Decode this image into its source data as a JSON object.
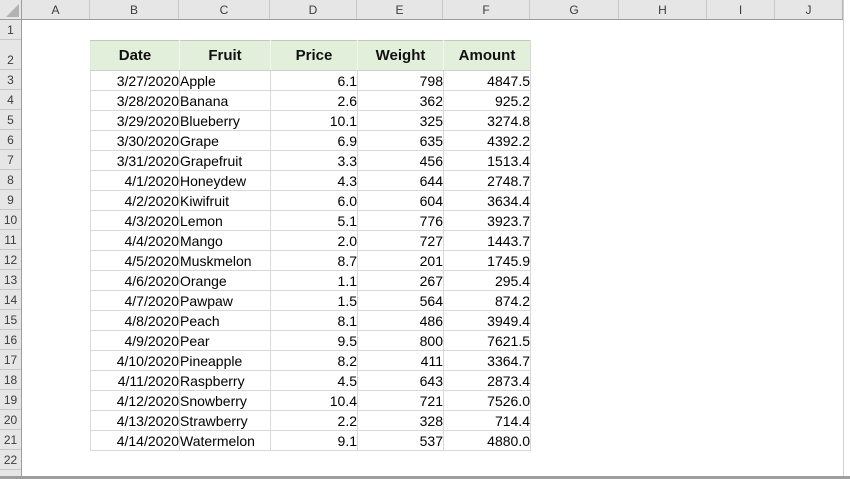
{
  "spreadsheet": {
    "column_letters": [
      "A",
      "B",
      "C",
      "D",
      "E",
      "F",
      "G",
      "H",
      "I",
      "J"
    ],
    "row_numbers": [
      "1",
      "2",
      "3",
      "4",
      "5",
      "6",
      "7",
      "8",
      "9",
      "10",
      "11",
      "12",
      "13",
      "14",
      "15",
      "16",
      "17",
      "18",
      "19",
      "20",
      "21",
      "22"
    ],
    "colors": {
      "table_header_fill": "#e2efda",
      "panel_fill": "#e6e6e6",
      "grid_border": "#d9d9d9"
    },
    "table": {
      "headers": [
        "Date",
        "Fruit",
        "Price",
        "Weight",
        "Amount"
      ],
      "rows": [
        {
          "date": "3/27/2020",
          "fruit": "Apple",
          "price": "6.1",
          "weight": "798",
          "amount": "4847.5"
        },
        {
          "date": "3/28/2020",
          "fruit": "Banana",
          "price": "2.6",
          "weight": "362",
          "amount": "925.2"
        },
        {
          "date": "3/29/2020",
          "fruit": "Blueberry",
          "price": "10.1",
          "weight": "325",
          "amount": "3274.8"
        },
        {
          "date": "3/30/2020",
          "fruit": "Grape",
          "price": "6.9",
          "weight": "635",
          "amount": "4392.2"
        },
        {
          "date": "3/31/2020",
          "fruit": "Grapefruit",
          "price": "3.3",
          "weight": "456",
          "amount": "1513.4"
        },
        {
          "date": "4/1/2020",
          "fruit": "Honeydew",
          "price": "4.3",
          "weight": "644",
          "amount": "2748.7"
        },
        {
          "date": "4/2/2020",
          "fruit": "Kiwifruit",
          "price": "6.0",
          "weight": "604",
          "amount": "3634.4"
        },
        {
          "date": "4/3/2020",
          "fruit": "Lemon",
          "price": "5.1",
          "weight": "776",
          "amount": "3923.7"
        },
        {
          "date": "4/4/2020",
          "fruit": "Mango",
          "price": "2.0",
          "weight": "727",
          "amount": "1443.7"
        },
        {
          "date": "4/5/2020",
          "fruit": "Muskmelon",
          "price": "8.7",
          "weight": "201",
          "amount": "1745.9"
        },
        {
          "date": "4/6/2020",
          "fruit": "Orange",
          "price": "1.1",
          "weight": "267",
          "amount": "295.4"
        },
        {
          "date": "4/7/2020",
          "fruit": "Pawpaw",
          "price": "1.5",
          "weight": "564",
          "amount": "874.2"
        },
        {
          "date": "4/8/2020",
          "fruit": "Peach",
          "price": "8.1",
          "weight": "486",
          "amount": "3949.4"
        },
        {
          "date": "4/9/2020",
          "fruit": "Pear",
          "price": "9.5",
          "weight": "800",
          "amount": "7621.5"
        },
        {
          "date": "4/10/2020",
          "fruit": "Pineapple",
          "price": "8.2",
          "weight": "411",
          "amount": "3364.7"
        },
        {
          "date": "4/11/2020",
          "fruit": "Raspberry",
          "price": "4.5",
          "weight": "643",
          "amount": "2873.4"
        },
        {
          "date": "4/12/2020",
          "fruit": "Snowberry",
          "price": "10.4",
          "weight": "721",
          "amount": "7526.0"
        },
        {
          "date": "4/13/2020",
          "fruit": "Strawberry",
          "price": "2.2",
          "weight": "328",
          "amount": "714.4"
        },
        {
          "date": "4/14/2020",
          "fruit": "Watermelon",
          "price": "9.1",
          "weight": "537",
          "amount": "4880.0"
        }
      ]
    }
  }
}
